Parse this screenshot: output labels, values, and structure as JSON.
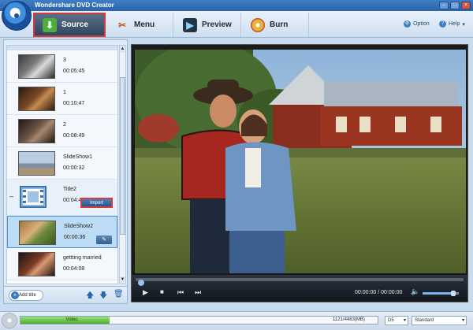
{
  "app": {
    "title": "Wondershare DVD Creator"
  },
  "tabs": [
    {
      "label": "Source",
      "icon": "download-icon",
      "active": true
    },
    {
      "label": "Menu",
      "icon": "tools-icon",
      "active": false
    },
    {
      "label": "Preview",
      "icon": "film-icon",
      "active": false
    },
    {
      "label": "Burn",
      "icon": "burn-disc-icon",
      "active": false
    }
  ],
  "options": {
    "option_label": "Option",
    "help_label": "Help"
  },
  "items": [
    {
      "name": "3",
      "duration": "00:05:45"
    },
    {
      "name": "1",
      "duration": "00:10:47"
    },
    {
      "name": "2",
      "duration": "00:08:49"
    },
    {
      "name": "SlideShow1",
      "duration": "00:00:32"
    }
  ],
  "title_item": {
    "name": "Title2",
    "duration": "00:04:44",
    "import_label": "Import"
  },
  "items_after": [
    {
      "name": "SlideShow2",
      "duration": "00:00:36"
    },
    {
      "name": "gettting married",
      "duration": "00:04:08"
    }
  ],
  "left_footer": {
    "add_title_label": "Add title"
  },
  "player": {
    "current_time": "00:00:00",
    "separator": "/",
    "total_time": "00:00:00",
    "progress": 0,
    "volume": 0.85
  },
  "status": {
    "capacity_label": "Video",
    "capacity_text": "1121/4483(MB)",
    "disc_type": "D5",
    "quality": "Standard",
    "used_fraction": 0.25
  }
}
